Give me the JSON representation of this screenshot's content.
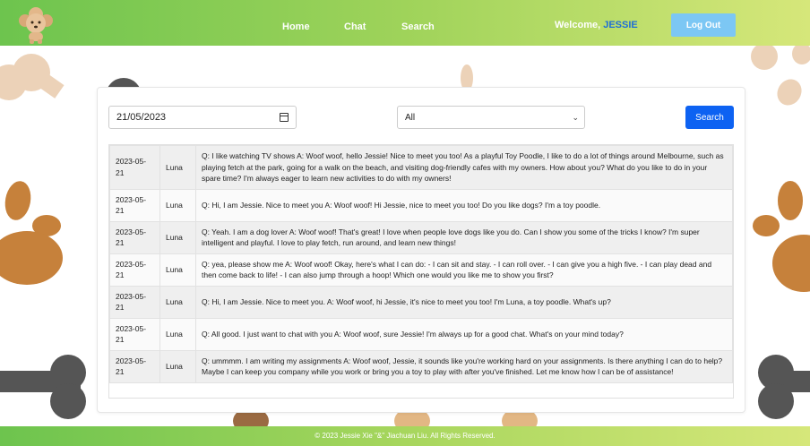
{
  "header": {
    "nav": [
      {
        "label": "Home"
      },
      {
        "label": "Chat"
      },
      {
        "label": "Search"
      }
    ],
    "welcome_prefix": "Welcome, ",
    "username": "JESSIE",
    "logout_label": "Log Out"
  },
  "filters": {
    "date_value": "21/05/2023",
    "select_value": "All",
    "search_label": "Search"
  },
  "table": {
    "rows": [
      {
        "date": "2023-05-21",
        "name": "Luna",
        "text": "Q: I like watching TV shows A: Woof woof, hello Jessie! Nice to meet you too! As a playful Toy Poodle, I like to do a lot of things around Melbourne, such as playing fetch at the park, going for a walk on the beach, and visiting dog-friendly cafes with my owners. How about you? What do you like to do in your spare time? I'm always eager to learn new activities to do with my owners!"
      },
      {
        "date": "2023-05-21",
        "name": "Luna",
        "text": "Q: Hi, I am Jessie. Nice to meet you A: Woof woof! Hi Jessie, nice to meet you too! Do you like dogs? I'm a toy poodle."
      },
      {
        "date": "2023-05-21",
        "name": "Luna",
        "text": "Q: Yeah. I am a dog lover A: Woof woof! That's great! I love when people love dogs like you do. Can I show you some of the tricks I know? I'm super intelligent and playful. I love to play fetch, run around, and learn new things!"
      },
      {
        "date": "2023-05-21",
        "name": "Luna",
        "text": "Q: yea, please show me A: Woof woof! Okay, here's what I can do: - I can sit and stay. - I can roll over. - I can give you a high five. - I can play dead and then come back to life! - I can also jump through a hoop! Which one would you like me to show you first?"
      },
      {
        "date": "2023-05-21",
        "name": "Luna",
        "text": "Q: Hi, I am Jessie. Nice to meet you. A: Woof woof, hi Jessie, it's nice to meet you too! I'm Luna, a toy poodle. What's up?"
      },
      {
        "date": "2023-05-21",
        "name": "Luna",
        "text": "Q: All good. I just want to chat with you A: Woof woof, sure Jessie! I'm always up for a good chat. What's on your mind today?"
      },
      {
        "date": "2023-05-21",
        "name": "Luna",
        "text": "Q: ummmm. I am writing my assignments A: Woof woof, Jessie, it sounds like you're working hard on your assignments. Is there anything I can do to help? Maybe I can keep you company while you work or bring you a toy to play with after you've finished. Let me know how I can be of assistance!"
      }
    ]
  },
  "footer": {
    "text": "© 2023 Jessie Xie \"&\" Jiachuan Liu. All Rights Reserved."
  },
  "colors": {
    "header_start": "#6dc44e",
    "header_end": "#d6e77a",
    "username": "#1f6fd6",
    "logout_bg": "#7cc7f4",
    "search_btn": "#0d62f2"
  },
  "icons": {
    "logo": "poodle-logo",
    "date_picker": "calendar-icon",
    "select": "chevron-down-icon"
  }
}
